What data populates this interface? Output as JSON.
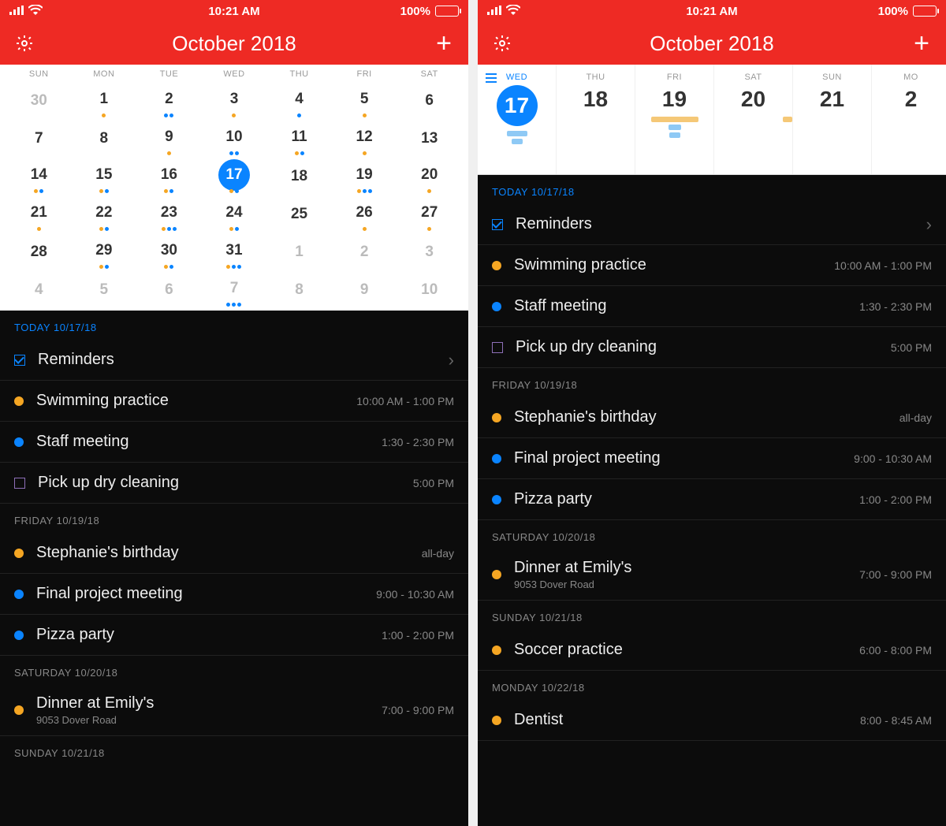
{
  "status": {
    "time": "10:21 AM",
    "battery": "100%"
  },
  "header": {
    "title": "October 2018"
  },
  "month": {
    "dow": [
      "SUN",
      "MON",
      "TUE",
      "WED",
      "THU",
      "FRI",
      "SAT"
    ],
    "weeks": [
      [
        {
          "n": "30",
          "out": true
        },
        {
          "n": "1",
          "dots": [
            "o"
          ]
        },
        {
          "n": "2",
          "dots": [
            "b",
            "b"
          ]
        },
        {
          "n": "3",
          "dots": [
            "o"
          ]
        },
        {
          "n": "4",
          "dots": [
            "b"
          ]
        },
        {
          "n": "5",
          "dots": [
            "o"
          ]
        },
        {
          "n": "6"
        }
      ],
      [
        {
          "n": "7"
        },
        {
          "n": "8"
        },
        {
          "n": "9",
          "dots": [
            "o"
          ]
        },
        {
          "n": "10",
          "dots": [
            "b",
            "b"
          ]
        },
        {
          "n": "11",
          "dots": [
            "o",
            "b"
          ]
        },
        {
          "n": "12",
          "dots": [
            "o"
          ]
        },
        {
          "n": "13"
        }
      ],
      [
        {
          "n": "14",
          "dots": [
            "o",
            "b"
          ]
        },
        {
          "n": "15",
          "dots": [
            "o",
            "b"
          ]
        },
        {
          "n": "16",
          "dots": [
            "o",
            "b"
          ]
        },
        {
          "n": "17",
          "sel": true,
          "dots": [
            "o",
            "b"
          ]
        },
        {
          "n": "18"
        },
        {
          "n": "19",
          "dots": [
            "o",
            "b",
            "b"
          ]
        },
        {
          "n": "20",
          "dots": [
            "o"
          ]
        }
      ],
      [
        {
          "n": "21",
          "dots": [
            "o"
          ]
        },
        {
          "n": "22",
          "dots": [
            "o",
            "b"
          ]
        },
        {
          "n": "23",
          "dots": [
            "o",
            "b",
            "b"
          ]
        },
        {
          "n": "24",
          "dots": [
            "o",
            "b"
          ]
        },
        {
          "n": "25"
        },
        {
          "n": "26",
          "dots": [
            "o"
          ]
        },
        {
          "n": "27",
          "dots": [
            "o"
          ]
        }
      ],
      [
        {
          "n": "28"
        },
        {
          "n": "29",
          "dots": [
            "o",
            "b"
          ]
        },
        {
          "n": "30",
          "dots": [
            "o",
            "b"
          ]
        },
        {
          "n": "31",
          "dots": [
            "o",
            "b",
            "b"
          ]
        },
        {
          "n": "1",
          "out": true
        },
        {
          "n": "2",
          "out": true
        },
        {
          "n": "3",
          "out": true
        }
      ],
      [
        {
          "n": "4",
          "out": true
        },
        {
          "n": "5",
          "out": true
        },
        {
          "n": "6",
          "out": true
        },
        {
          "n": "7",
          "out": true,
          "dots": [
            "b",
            "b",
            "b"
          ]
        },
        {
          "n": "8",
          "out": true
        },
        {
          "n": "9",
          "out": true
        },
        {
          "n": "10",
          "out": true
        }
      ]
    ]
  },
  "weekstrip": [
    {
      "wd": "WED",
      "n": "17",
      "sel": true,
      "bars": [
        {
          "c": "b",
          "w": 26
        },
        {
          "c": "b",
          "w": 14
        }
      ]
    },
    {
      "wd": "THU",
      "n": "18"
    },
    {
      "wd": "FRI",
      "n": "19",
      "bars": [
        {
          "c": "o",
          "w": 60
        },
        {
          "c": "b",
          "w": 16
        },
        {
          "c": "b",
          "w": 14
        }
      ]
    },
    {
      "wd": "SAT",
      "n": "20",
      "bars": [
        {
          "c": "o",
          "w": 12,
          "right": true
        }
      ]
    },
    {
      "wd": "SUN",
      "n": "21"
    },
    {
      "wd": "MO",
      "n": "2",
      "cut": true
    }
  ],
  "agenda": {
    "sections": [
      {
        "label": "TODAY 10/17/18",
        "today": true,
        "items": [
          {
            "kind": "reminders",
            "text": "Reminders"
          },
          {
            "color": "orange",
            "text": "Swimming practice",
            "time": "10:00 AM - 1:00 PM"
          },
          {
            "color": "blue",
            "text": "Staff meeting",
            "time": "1:30 - 2:30 PM"
          },
          {
            "kind": "todo",
            "text": "Pick up dry cleaning",
            "time": "5:00 PM"
          }
        ]
      },
      {
        "label": "FRIDAY 10/19/18",
        "items": [
          {
            "color": "orange",
            "text": "Stephanie's birthday",
            "time": "all-day"
          },
          {
            "color": "blue",
            "text": "Final project meeting",
            "time": "9:00 - 10:30 AM"
          },
          {
            "color": "blue",
            "text": "Pizza party",
            "time": "1:00 - 2:00 PM"
          }
        ]
      },
      {
        "label": "SATURDAY 10/20/18",
        "items": [
          {
            "color": "orange",
            "text": "Dinner at Emily's",
            "sub": "9053 Dover Road",
            "time": "7:00 - 9:00 PM"
          }
        ]
      },
      {
        "label": "SUNDAY 10/21/18",
        "items": []
      }
    ],
    "sections_right": [
      {
        "label": "TODAY 10/17/18",
        "today": true,
        "items": [
          {
            "kind": "reminders",
            "text": "Reminders"
          },
          {
            "color": "orange",
            "text": "Swimming practice",
            "time": "10:00 AM - 1:00 PM"
          },
          {
            "color": "blue",
            "text": "Staff meeting",
            "time": "1:30 - 2:30 PM"
          },
          {
            "kind": "todo",
            "text": "Pick up dry cleaning",
            "time": "5:00 PM"
          }
        ]
      },
      {
        "label": "FRIDAY 10/19/18",
        "items": [
          {
            "color": "orange",
            "text": "Stephanie's birthday",
            "time": "all-day"
          },
          {
            "color": "blue",
            "text": "Final project meeting",
            "time": "9:00 - 10:30 AM"
          },
          {
            "color": "blue",
            "text": "Pizza party",
            "time": "1:00 - 2:00 PM"
          }
        ]
      },
      {
        "label": "SATURDAY 10/20/18",
        "items": [
          {
            "color": "orange",
            "text": "Dinner at Emily's",
            "sub": "9053 Dover Road",
            "time": "7:00 - 9:00 PM"
          }
        ]
      },
      {
        "label": "SUNDAY 10/21/18",
        "items": [
          {
            "color": "orange",
            "text": "Soccer practice",
            "time": "6:00 - 8:00 PM"
          }
        ]
      },
      {
        "label": "MONDAY 10/22/18",
        "items": [
          {
            "color": "orange",
            "text": "Dentist",
            "time": "8:00 - 8:45 AM"
          }
        ]
      }
    ]
  }
}
